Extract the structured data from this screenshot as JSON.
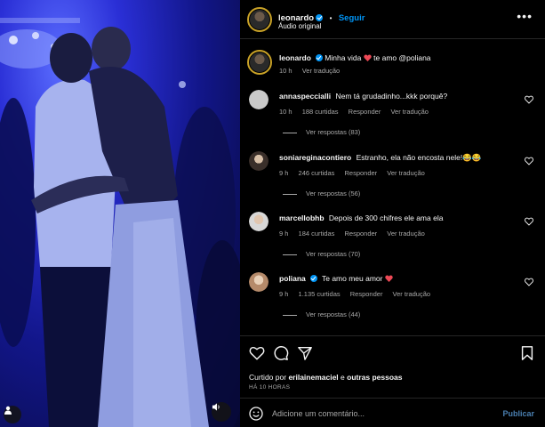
{
  "post": {
    "author": "leonardo",
    "follow_label": "Seguir",
    "separator": "•",
    "audio": "Áudio original",
    "more_icon": "more-horizontal-icon"
  },
  "caption": {
    "author": "leonardo",
    "text_before": "Minha vida",
    "text_after": "te amo @poliana",
    "time": "10 h",
    "translate": "Ver tradução"
  },
  "comments": [
    {
      "author": "annaspeccialli",
      "text": "Nem tá grudadinho...kkk porquê?",
      "time": "10 h",
      "likes": "188 curtidas",
      "reply": "Responder",
      "translate": "Ver tradução",
      "replies": "Ver respostas (83)",
      "avatar_color": "#c9c9c9"
    },
    {
      "author": "soniareginacontiero",
      "text": "Estranho, ela não encosta nele!😂😂",
      "time": "9 h",
      "likes": "246 curtidas",
      "reply": "Responder",
      "translate": "Ver tradução",
      "replies": "Ver respostas (56)",
      "avatar_color": "#7a6a60"
    },
    {
      "author": "marcellobhb",
      "text": "Depois de 300 chifres ele ama ela",
      "time": "9 h",
      "likes": "184 curtidas",
      "reply": "Responder",
      "translate": "Ver tradução",
      "replies": "Ver respostas (70)",
      "avatar_color": "#d8d8d8"
    },
    {
      "author": "poliana",
      "text": "Te amo meu amor",
      "time": "9 h",
      "likes": "1.135 curtidas",
      "reply": "Responder",
      "translate": "Ver tradução",
      "replies": "Ver respostas (44)",
      "avatar_color": "#b58a6a",
      "verified": true
    }
  ],
  "actions": {
    "liked_prefix": "Curtido por",
    "liked_user": "erilainemaciel",
    "liked_conj": "e",
    "liked_others": "outras pessoas",
    "time_ago": "HÁ 10 HORAS"
  },
  "composer": {
    "placeholder": "Adicione um comentário...",
    "publish": "Publicar"
  },
  "colors": {
    "accent": "#0095f6",
    "heart": "#ed4956",
    "publish_disabled": "#4a7fb0"
  }
}
